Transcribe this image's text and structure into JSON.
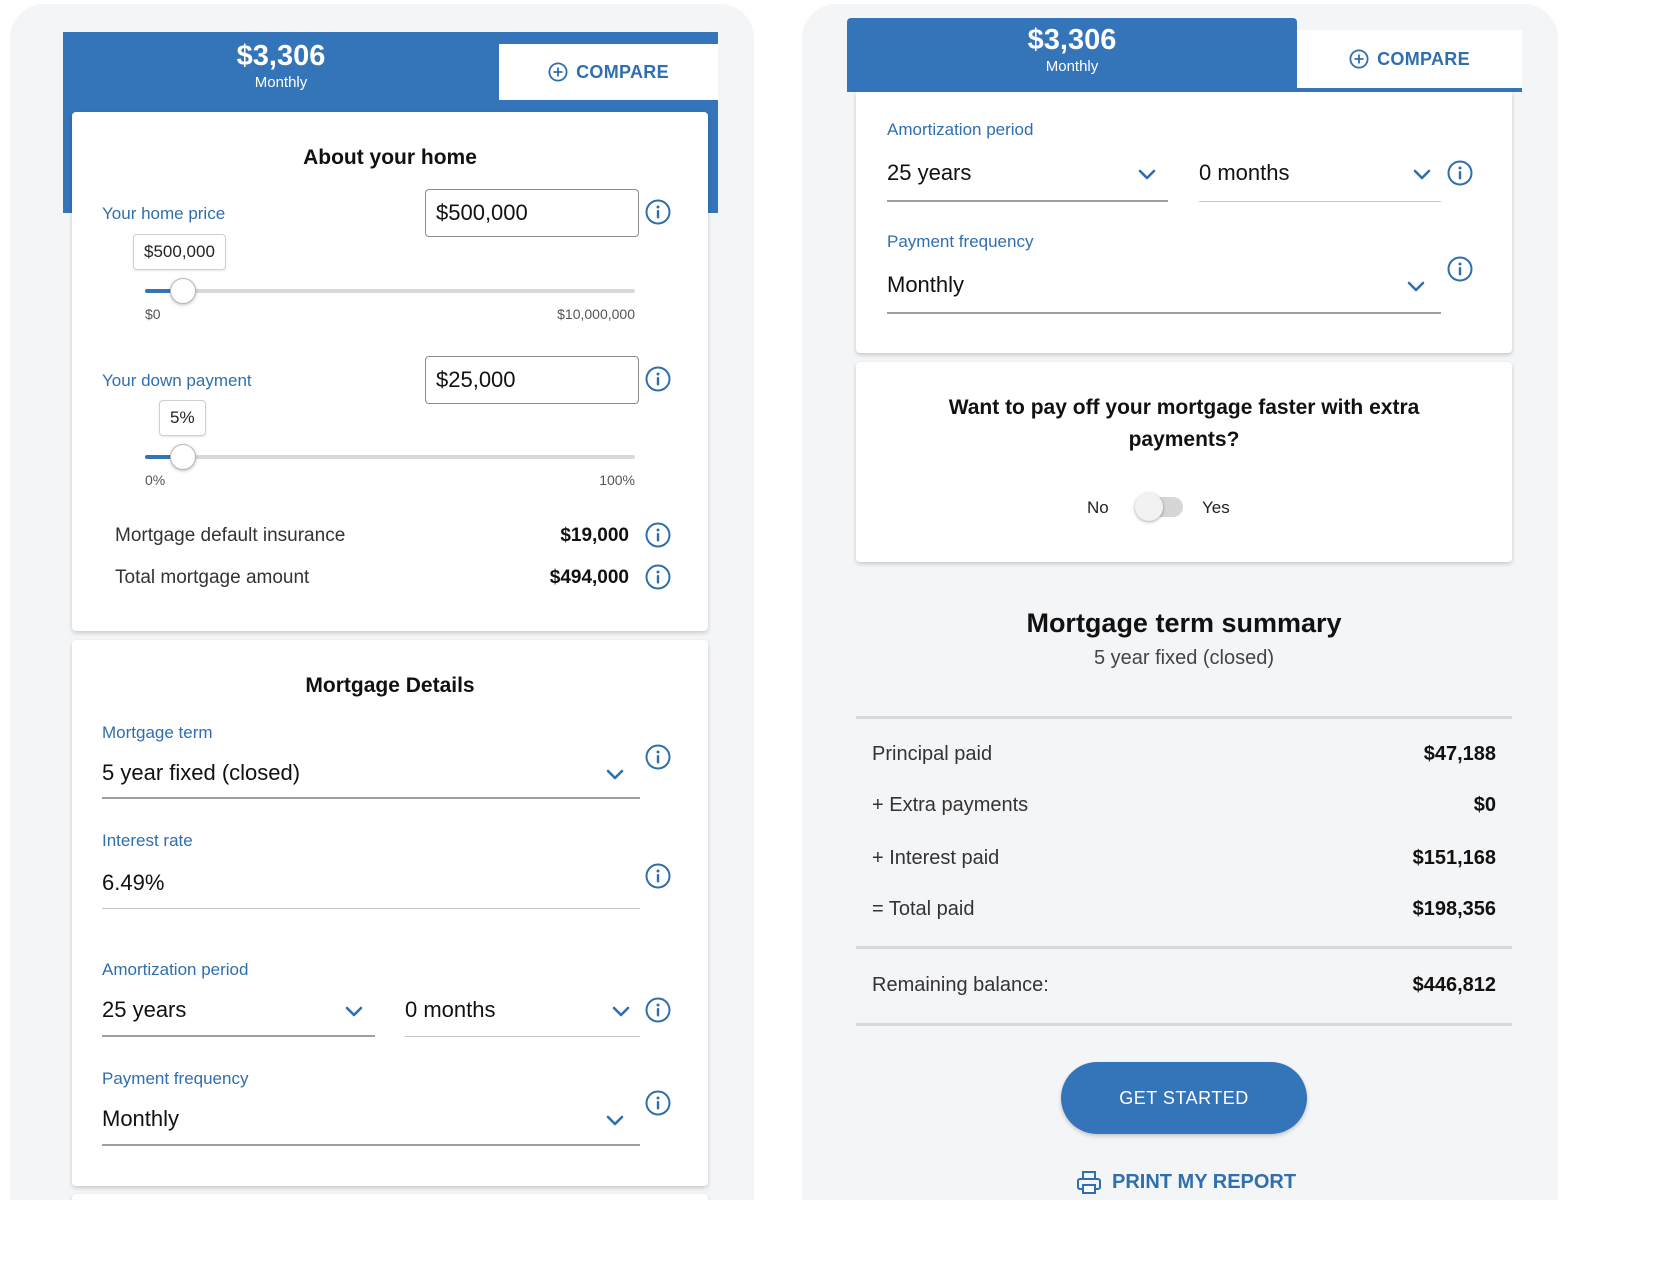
{
  "left": {
    "header": {
      "amount": "$3,306",
      "period": "Monthly",
      "compare_label": "COMPARE"
    },
    "home": {
      "title": "About your home",
      "price_label": "Your home price",
      "price_value": "$500,000",
      "price_bubble": "$500,000",
      "price_min": "$0",
      "price_max": "$10,000,000",
      "price_slider_fraction": 0.05,
      "down_label": "Your down payment",
      "down_value": "$25,000",
      "down_bubble": "5%",
      "down_min": "0%",
      "down_max": "100%",
      "down_slider_fraction": 0.05,
      "insurance_label": "Mortgage default insurance",
      "insurance_value": "$19,000",
      "total_label": "Total mortgage amount",
      "total_value": "$494,000"
    },
    "details": {
      "title": "Mortgage Details",
      "term_label": "Mortgage term",
      "term_value": "5 year fixed (closed)",
      "rate_label": "Interest rate",
      "rate_value": "6.49%",
      "amort_label": "Amortization period",
      "amort_years": "25 years",
      "amort_months": "0 months",
      "freq_label": "Payment frequency",
      "freq_value": "Monthly"
    }
  },
  "right": {
    "header": {
      "amount": "$3,306",
      "period": "Monthly",
      "compare_label": "COMPARE"
    },
    "amort_label": "Amortization period",
    "amort_years": "25 years",
    "amort_months": "0 months",
    "freq_label": "Payment frequency",
    "freq_value": "Monthly",
    "extra": {
      "question": "Want to pay off your mortgage faster with extra payments?",
      "no_label": "No",
      "yes_label": "Yes",
      "enabled": false
    },
    "summary": {
      "title": "Mortgage term summary",
      "subtitle": "5 year fixed (closed)",
      "rows": [
        {
          "label": "Principal paid",
          "value": "$47,188"
        },
        {
          "label": "+ Extra payments",
          "value": "$0"
        },
        {
          "label": "+ Interest paid",
          "value": "$151,168"
        },
        {
          "label": "= Total paid",
          "value": "$198,356"
        }
      ],
      "remaining_label": "Remaining balance:",
      "remaining_value": "$446,812"
    },
    "cta_label": "GET STARTED",
    "print_label": "PRINT MY REPORT"
  },
  "colors": {
    "brand": "#3474b9",
    "link": "#2f6fae",
    "background": "#f4f5f7"
  }
}
